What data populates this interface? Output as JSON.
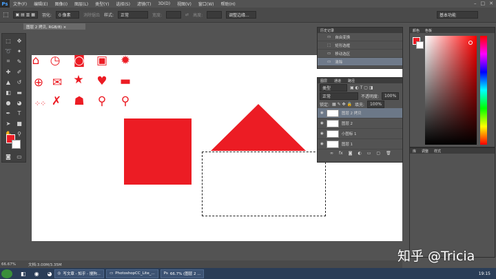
{
  "app": {
    "logo": "Ps",
    "menus": [
      "文件(F)",
      "编辑(E)",
      "图像(I)",
      "图层(L)",
      "类型(Y)",
      "选择(S)",
      "滤镜(T)",
      "3D(D)",
      "视图(V)",
      "窗口(W)",
      "帮助(H)"
    ]
  },
  "options": {
    "feather_label": "羽化:",
    "feather_value": "0 像素",
    "antialias": "消除锯齿",
    "style_label": "样式:",
    "style_value": "正常",
    "width_label": "宽度:",
    "height_label": "高度:",
    "refine": "调整边缘...",
    "workspace": "基本功能"
  },
  "document": {
    "tab_title": "图层 2 拷贝, RGB/8) ×"
  },
  "history": {
    "tabs": [
      "历史记录"
    ],
    "items": [
      "自由变换",
      "矩形选框",
      "移动选区",
      "清除"
    ]
  },
  "layers": {
    "tabs": [
      "图层",
      "通道",
      "路径"
    ],
    "kind_label": "类型",
    "blend": "正常",
    "opacity_label": "不透明度:",
    "opacity": "100%",
    "lock_label": "锁定:",
    "fill_label": "填充:",
    "fill": "100%",
    "rows": [
      "图层 2 拷贝",
      "图层 2",
      "小图标 1",
      "图层 1"
    ]
  },
  "color_panel": {
    "tabs": [
      "颜色",
      "色板"
    ]
  },
  "adjust_panel": {
    "tabs": [
      "库",
      "调整",
      "样式"
    ]
  },
  "status": {
    "zoom": "66.67%",
    "doc": "文档:3.00M/3.35M"
  },
  "taskbar": {
    "tasks": [
      "写文章 - 知乎 - 搜狗...",
      "PhotoshopCC_Lite_...",
      "66.7% (图层 2 ..."
    ],
    "time": "19:15"
  },
  "watermark": "知乎 @Tricia",
  "colors": {
    "accent": "#ec1c24"
  }
}
